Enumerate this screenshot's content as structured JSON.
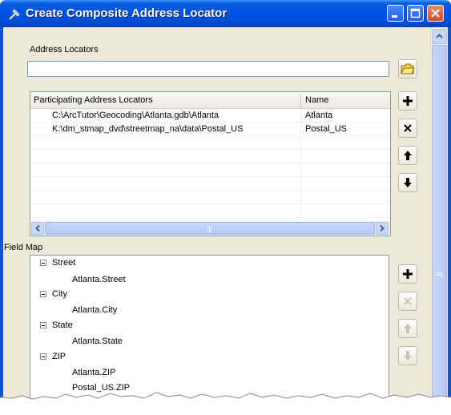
{
  "window": {
    "title": "Create Composite Address Locator",
    "controls": [
      "minimize",
      "maximize",
      "close"
    ]
  },
  "address_locators": {
    "label": "Address Locators",
    "value": "",
    "placeholder": ""
  },
  "locator_table": {
    "columns": [
      "Participating Address Locators",
      "Name"
    ],
    "rows": [
      {
        "path": "C:\\ArcTutor\\Geocoding\\Atlanta.gdb\\Atlanta",
        "name": "Atlanta"
      },
      {
        "path": "K:\\dm_stmap_dvd\\streetmap_na\\data\\Postal_US",
        "name": "Postal_US"
      }
    ]
  },
  "locator_buttons": [
    "folder-open-icon",
    "add-icon",
    "delete-icon",
    "move-up-icon",
    "move-down-icon"
  ],
  "field_map": {
    "label": "Field Map",
    "nodes": [
      {
        "name": "Street",
        "children": [
          "Atlanta.Street"
        ]
      },
      {
        "name": "City",
        "children": [
          "Atlanta.City"
        ]
      },
      {
        "name": "State",
        "children": [
          "Atlanta.State"
        ]
      },
      {
        "name": "ZIP",
        "children": [
          "Atlanta.ZIP",
          "Postal_US.ZIP"
        ]
      }
    ]
  },
  "field_map_buttons": [
    "add-icon",
    "delete-icon",
    "move-up-icon",
    "move-down-icon"
  ],
  "colors": {
    "titlebar": "#0054e3",
    "client_bg": "#ece9d8",
    "input_border": "#7f9db9"
  }
}
